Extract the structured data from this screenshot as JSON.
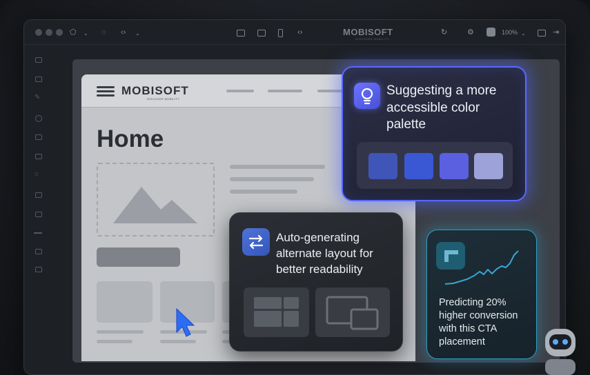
{
  "app": {
    "brand": "MOBISOFT",
    "brand_tagline": "DISCOVER MOBILITY",
    "zoom": "100%"
  },
  "mockup": {
    "brand": "MOBISOFT",
    "brand_tagline": "DISCOVER MOBILITY",
    "page_title": "Home"
  },
  "suggestions": {
    "color_palette": {
      "text": "Suggesting a more accessible color palette",
      "swatches": [
        "#3f55b8",
        "#3a58d4",
        "#5a60e0",
        "#9da3d8"
      ]
    },
    "layout": {
      "text": "Auto-generating alternate layout for better readability"
    },
    "conversion": {
      "text": "Predicting 20% higher conversion with this CTA placement"
    }
  },
  "colors": {
    "accent_blue": "#5b68ff",
    "accent_cyan": "#2f9fc3",
    "cursor": "#2d6df6"
  }
}
